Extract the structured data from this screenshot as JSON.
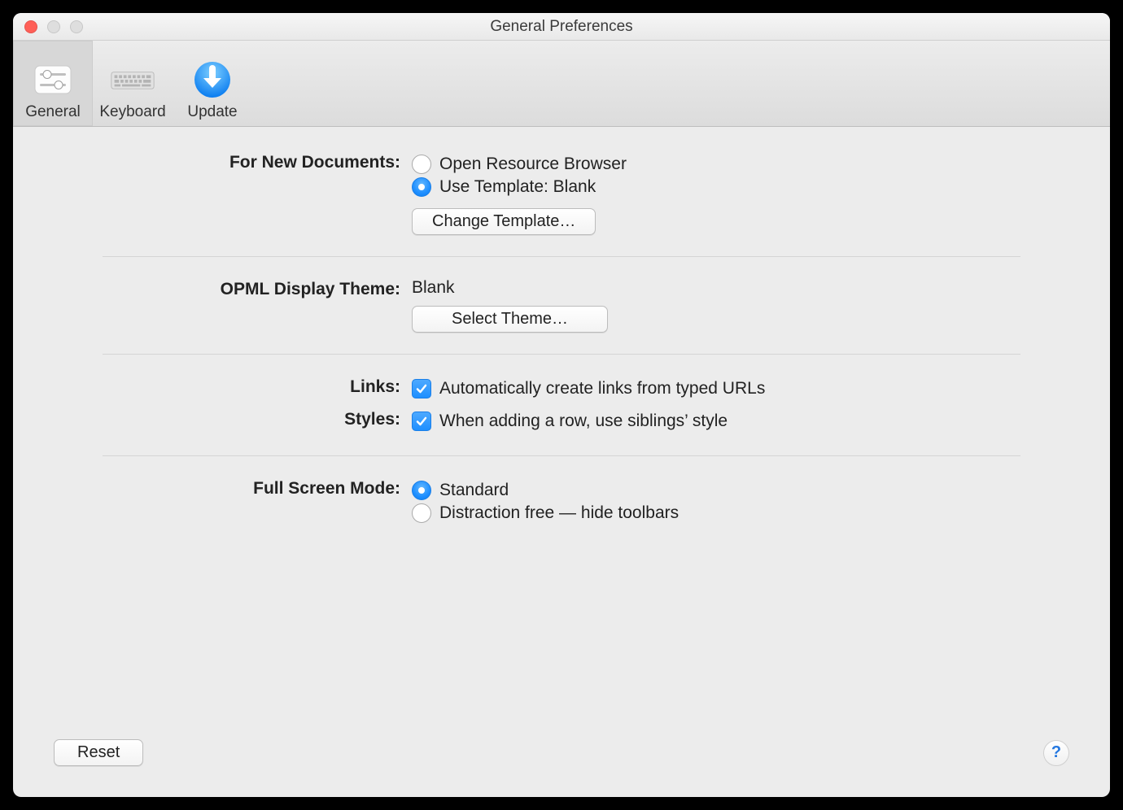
{
  "window": {
    "title": "General Preferences"
  },
  "toolbar": {
    "items": [
      {
        "label": "General",
        "selected": true
      },
      {
        "label": "Keyboard",
        "selected": false
      },
      {
        "label": "Update",
        "selected": false
      }
    ]
  },
  "sections": {
    "newDocuments": {
      "label": "For New Documents:",
      "openResource": "Open Resource Browser",
      "useTemplate": "Use Template: Blank",
      "changeTemplate": "Change Template…",
      "selected": "useTemplate"
    },
    "opml": {
      "label": "OPML Display Theme:",
      "value": "Blank",
      "selectTheme": "Select Theme…"
    },
    "links": {
      "label": "Links:",
      "auto": "Automatically create links from typed URLs",
      "checked": true
    },
    "styles": {
      "label": "Styles:",
      "siblings": "When adding a row, use siblings’ style",
      "checked": true
    },
    "fullscreen": {
      "label": "Full Screen Mode:",
      "standard": "Standard",
      "distraction": "Distraction free — hide toolbars",
      "selected": "standard"
    }
  },
  "footer": {
    "reset": "Reset",
    "help": "?"
  }
}
